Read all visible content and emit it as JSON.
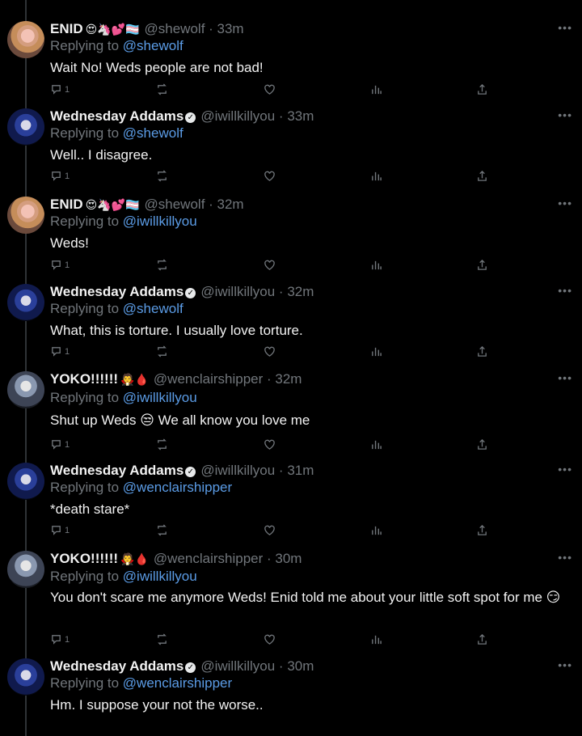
{
  "tweets": [
    {
      "name": "ENID",
      "emoji": "😍🦄💕🏳️‍⚧️",
      "verified": false,
      "handle": "@shewolf · 33m",
      "replying_label": "Replying to",
      "replying_to": "@shewolf",
      "text": "Wait No! Weds people are not bad!",
      "reply_count": "1",
      "avatar": "enid-avatar"
    },
    {
      "name": "Wednesday Addams",
      "emoji": "",
      "verified": true,
      "handle": "@iwillkillyou · 33m",
      "replying_label": "Replying to",
      "replying_to": "@shewolf",
      "text": "Well.. I disagree.",
      "reply_count": "1",
      "avatar": "wednesday-avatar"
    },
    {
      "name": "ENID",
      "emoji": "😍🦄💕🏳️‍⚧️",
      "verified": false,
      "handle": "@shewolf · 32m",
      "replying_label": "Replying to",
      "replying_to": "@iwillkillyou",
      "text": "Weds!",
      "reply_count": "1",
      "avatar": "enid-avatar"
    },
    {
      "name": "Wednesday Addams",
      "emoji": "",
      "verified": true,
      "handle": "@iwillkillyou · 32m",
      "replying_label": "Replying to",
      "replying_to": "@shewolf",
      "text": "What, this is torture. I usually love torture.",
      "reply_count": "1",
      "avatar": "wednesday-avatar"
    },
    {
      "name": "YOKO!!!!!!",
      "emoji": "🧛🩸",
      "verified": false,
      "handle": "@wenclairshipper · 32m",
      "replying_label": "Replying to",
      "replying_to": "@iwillkillyou",
      "text": "Shut up Weds 😒 We all know you love me",
      "reply_count": "1",
      "avatar": "yoko-avatar"
    },
    {
      "name": "Wednesday Addams",
      "emoji": "",
      "verified": true,
      "handle": "@iwillkillyou · 31m",
      "replying_label": "Replying to",
      "replying_to": "@wenclairshipper",
      "text": "*death stare*",
      "reply_count": "1",
      "avatar": "wednesday-avatar"
    },
    {
      "name": "YOKO!!!!!!",
      "emoji": "🧛🩸",
      "verified": false,
      "handle": "@wenclairshipper · 30m",
      "replying_label": "Replying to",
      "replying_to": "@iwillkillyou",
      "text": "You don't scare me anymore Weds! Enid told me about your little soft spot for me 😏",
      "reply_count": "1",
      "avatar": "yoko-avatar"
    },
    {
      "name": "Wednesday Addams",
      "emoji": "",
      "verified": true,
      "handle": "@iwillkillyou · 30m",
      "replying_label": "Replying to",
      "replying_to": "@wenclairshipper",
      "text": "Hm. I suppose your not the worse..",
      "reply_count": "",
      "avatar": "wednesday-avatar"
    }
  ],
  "icons": {
    "reply": "reply-icon",
    "retweet": "retweet-icon",
    "like": "like-icon",
    "views": "views-icon",
    "share": "share-icon",
    "more": "more-icon",
    "verified": "verified-icon"
  },
  "colors": {
    "background": "#000000",
    "text": "#e7e9ea",
    "muted": "#71767b",
    "mention": "#5b9ce6"
  }
}
